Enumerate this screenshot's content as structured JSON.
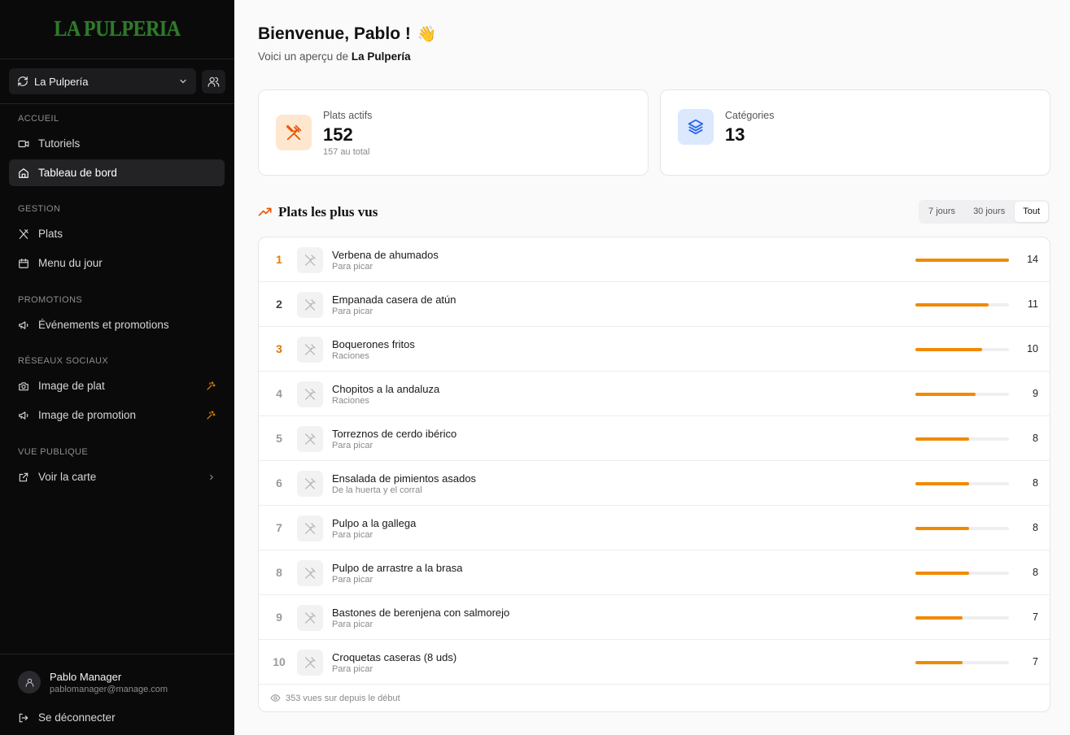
{
  "brand": {
    "logo": "LA PULPERIA"
  },
  "restaurant_selector": {
    "value": "La Pulpería"
  },
  "sidebar": {
    "sections": {
      "accueil": "ACCUEIL",
      "gestion": "GESTION",
      "promotions": "PROMOTIONS",
      "reseaux": "RÉSEAUX SOCIAUX",
      "vue": "VUE PUBLIQUE"
    },
    "items": {
      "tutoriels": "Tutoriels",
      "tableau": "Tableau de bord",
      "plats": "Plats",
      "menu": "Menu du jour",
      "evenements": "Événements et promotions",
      "image_plat": "Image de plat",
      "image_promo": "Image de promotion",
      "carte": "Voir la carte"
    },
    "user": {
      "name": "Pablo Manager",
      "email": "pablomanager@manage.com"
    },
    "logout": "Se déconnecter"
  },
  "header": {
    "title": "Bienvenue, Pablo !",
    "emoji": "👋",
    "subtitle_prefix": "Voici un aperçu de ",
    "subtitle_name": "La Pulpería"
  },
  "stats": {
    "plats": {
      "label": "Plats actifs",
      "value": "152",
      "sub": "157 au total"
    },
    "categories": {
      "label": "Catégories",
      "value": "13"
    }
  },
  "top_dishes": {
    "title": "Plats les plus vus",
    "periods": [
      "7 jours",
      "30 jours",
      "Tout"
    ],
    "active_period": "Tout",
    "max_views": 14,
    "rows": [
      {
        "rank": "1",
        "name": "Verbena de ahumados",
        "category": "Para picar",
        "views": "14",
        "fraction": 1.0
      },
      {
        "rank": "2",
        "name": "Empanada casera de atún",
        "category": "Para picar",
        "views": "11",
        "fraction": 0.786
      },
      {
        "rank": "3",
        "name": "Boquerones fritos",
        "category": "Raciones",
        "views": "10",
        "fraction": 0.714
      },
      {
        "rank": "4",
        "name": "Chopitos a la andaluza",
        "category": "Raciones",
        "views": "9",
        "fraction": 0.643
      },
      {
        "rank": "5",
        "name": "Torreznos de cerdo ibérico",
        "category": "Para picar",
        "views": "8",
        "fraction": 0.571
      },
      {
        "rank": "6",
        "name": "Ensalada de pimientos asados",
        "category": "De la huerta y el corral",
        "views": "8",
        "fraction": 0.571
      },
      {
        "rank": "7",
        "name": "Pulpo a la gallega",
        "category": "Para picar",
        "views": "8",
        "fraction": 0.571
      },
      {
        "rank": "8",
        "name": "Pulpo de arrastre a la brasa",
        "category": "Para picar",
        "views": "8",
        "fraction": 0.571
      },
      {
        "rank": "9",
        "name": "Bastones de berenjena con salmorejo",
        "category": "Para picar",
        "views": "7",
        "fraction": 0.5
      },
      {
        "rank": "10",
        "name": "Croquetas caseras (8 uds)",
        "category": "Para picar",
        "views": "7",
        "fraction": 0.5
      }
    ],
    "rank_colors": [
      "#f07a00",
      "#444444",
      "#d97706",
      "#9a9a9e",
      "#9a9a9e",
      "#9a9a9e",
      "#9a9a9e",
      "#9a9a9e",
      "#9a9a9e",
      "#9a9a9e"
    ],
    "footer": "353 vues sur depuis le début"
  },
  "colors": {
    "accent": "#f08a00",
    "sidebar_bg": "#0a0a0b",
    "orange_soft": "#fde7cf",
    "blue_soft": "#dbe8fe"
  }
}
